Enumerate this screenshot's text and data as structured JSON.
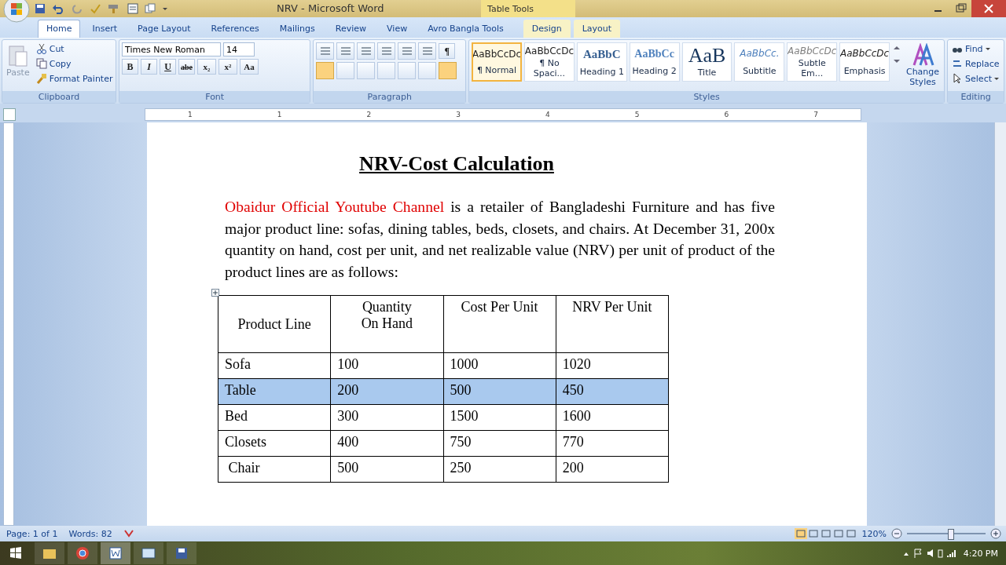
{
  "window": {
    "title": "NRV - Microsoft Word",
    "context_group": "Table Tools"
  },
  "tabs": [
    {
      "label": "Home",
      "selected": true,
      "kind": "main"
    },
    {
      "label": "Insert",
      "selected": false,
      "kind": "main"
    },
    {
      "label": "Page Layout",
      "selected": false,
      "kind": "main"
    },
    {
      "label": "References",
      "selected": false,
      "kind": "main"
    },
    {
      "label": "Mailings",
      "selected": false,
      "kind": "main"
    },
    {
      "label": "Review",
      "selected": false,
      "kind": "main"
    },
    {
      "label": "View",
      "selected": false,
      "kind": "main"
    },
    {
      "label": "Avro Bangla Tools",
      "selected": false,
      "kind": "main"
    },
    {
      "label": "Design",
      "selected": false,
      "kind": "context"
    },
    {
      "label": "Layout",
      "selected": false,
      "kind": "context"
    }
  ],
  "clipboard": {
    "title": "Clipboard",
    "paste": "Paste",
    "items": [
      "Cut",
      "Copy",
      "Format Painter"
    ]
  },
  "font": {
    "title": "Font",
    "name": "Times New Roman",
    "size": "14",
    "buttons": [
      "B",
      "I",
      "U",
      "abe",
      "x₂",
      "x²",
      "Aa"
    ]
  },
  "paragraph": {
    "title": "Paragraph",
    "pilcrow": "¶"
  },
  "styles": {
    "title": "Styles",
    "change": "Change Styles",
    "items": [
      {
        "sample": "AaBbCcDc",
        "label": "¶ Normal",
        "selected": true,
        "kind": "normal"
      },
      {
        "sample": "AaBbCcDc",
        "label": "¶ No Spaci...",
        "selected": false,
        "kind": "normal"
      },
      {
        "sample": "AaBbC",
        "label": "Heading 1",
        "selected": false,
        "kind": "heading1"
      },
      {
        "sample": "AaBbCc",
        "label": "Heading 2",
        "selected": false,
        "kind": "heading2"
      },
      {
        "sample": "AaB",
        "label": "Title",
        "selected": false,
        "kind": "title"
      },
      {
        "sample": "AaBbCc.",
        "label": "Subtitle",
        "selected": false,
        "kind": "subtitle"
      },
      {
        "sample": "AaBbCcDc",
        "label": "Subtle Em...",
        "selected": false,
        "kind": "subtle"
      },
      {
        "sample": "AaBbCcDc",
        "label": "Emphasis",
        "selected": false,
        "kind": "emphasis"
      }
    ]
  },
  "editing": {
    "title": "Editing",
    "items": [
      "Find",
      "Replace",
      "Select"
    ]
  },
  "ruler": [
    "1",
    "1",
    "2",
    "3",
    "4",
    "5",
    "6",
    "7"
  ],
  "document": {
    "title": "NRV-Cost Calculation",
    "lead": "Obaidur Official Youtube Channel",
    "body": "is a retailer of Bangladeshi Furniture and has five major product line: sofas, dining tables, beds, closets, and chairs. At December 31, 200x quantity on hand, cost per unit, and net realizable value (NRV) per unit of product of the product lines are as follows:",
    "table": {
      "columns": [
        "Product Line",
        "Quantity On Hand",
        "Cost Per Unit",
        "NRV Per Unit"
      ],
      "rows": [
        {
          "cells": [
            "Sofa",
            "100",
            "1000",
            "1020"
          ],
          "selected": false
        },
        {
          "cells": [
            "Table",
            "200",
            "500",
            "450"
          ],
          "selected": true
        },
        {
          "cells": [
            "Bed",
            "300",
            "1500",
            "1600"
          ],
          "selected": false
        },
        {
          "cells": [
            "Closets",
            "400",
            "750",
            "770"
          ],
          "selected": false
        },
        {
          "cells": [
            " Chair",
            "500",
            "250",
            "200"
          ],
          "selected": false
        }
      ]
    }
  },
  "status_bar": {
    "page": "Page: 1 of 1",
    "words": "Words: 82",
    "zoom": "120%"
  },
  "taskbar": {
    "time": "4:20 PM"
  }
}
